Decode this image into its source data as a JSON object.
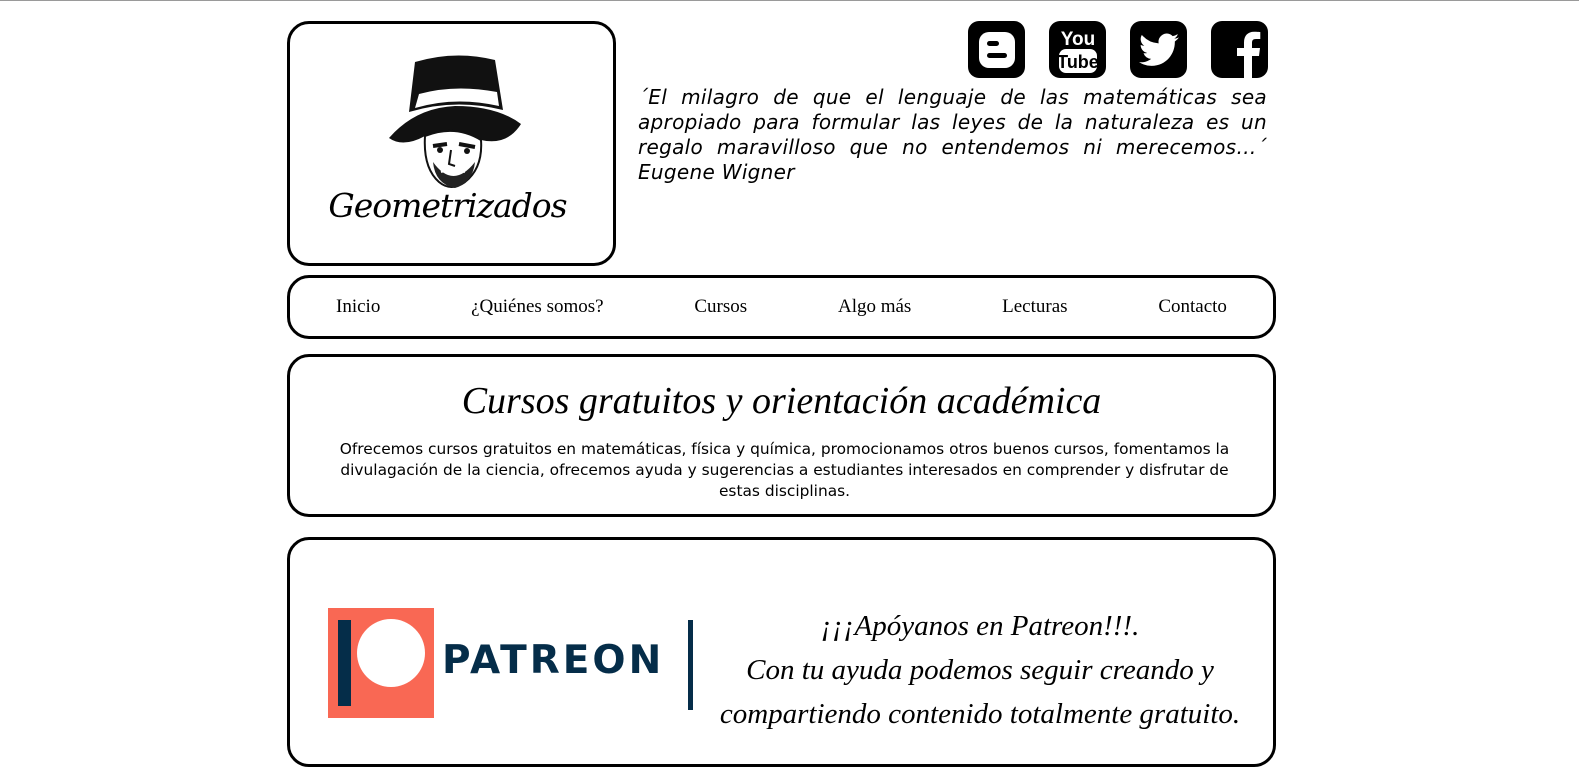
{
  "header": {
    "logo_text": "Geometrizados",
    "social": [
      {
        "icon": "blogger-icon",
        "glyph": "B"
      },
      {
        "icon": "youtube-icon",
        "line1": "You",
        "line2": "Tube"
      },
      {
        "icon": "twitter-icon"
      },
      {
        "icon": "facebook-icon",
        "glyph": "f"
      }
    ],
    "quote": "´El milagro de que el lenguaje de las matemáticas sea apropiado para formular las leyes de la naturaleza es un regalo maravilloso que no entendemos ni merecemos…´ Eugene Wigner"
  },
  "nav": {
    "items": [
      {
        "label": "Inicio"
      },
      {
        "label": "¿Quiénes somos?"
      },
      {
        "label": "Cursos"
      },
      {
        "label": "Algo más"
      },
      {
        "label": "Lecturas"
      },
      {
        "label": "Contacto"
      }
    ]
  },
  "intro": {
    "title": "Cursos gratuitos y orientación académica",
    "text": "Ofrecemos cursos gratuitos en matemáticas, física y química, promocionamos otros buenos cursos, fomentamos la divulagación de la ciencia, ofrecemos ayuda y sugerencias a estudiantes interesados en comprender y disfrutar de estas disciplinas."
  },
  "patreon": {
    "brand": "PATREON",
    "line1": "¡¡¡Apóyanos en Patreon!!!.",
    "line2": "Con tu ayuda podemos seguir creando y",
    "line3": "compartiendo contenido totalmente gratuito.",
    "colors": {
      "brand_coral": "#f96854",
      "brand_navy": "#052d49"
    }
  }
}
